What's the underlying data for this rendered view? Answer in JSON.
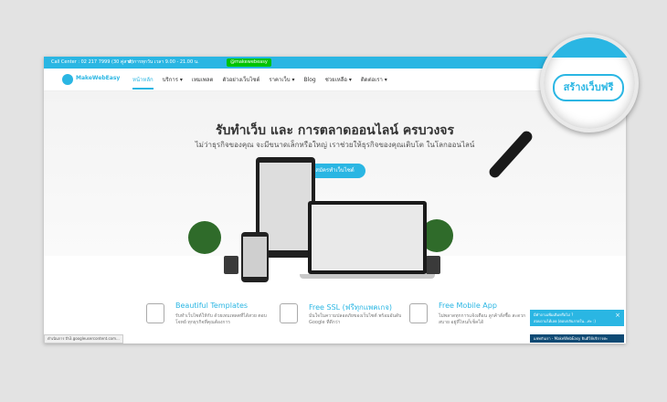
{
  "topbar": {
    "call_center": "Call Center : 02 217 7999 (30 คู่สาย)",
    "hours": "ทำการทุกวัน เวลา 9.00 - 21.00 น.",
    "line_id": "@makewebeasy"
  },
  "nav": {
    "brand": "MakeWebEasy",
    "items": [
      "หน้าหลัก",
      "บริการ ▾",
      "เทมเพลต",
      "ตัวอย่างเว็บไซต์",
      "ราคาเว็บ ▾",
      "Blog",
      "ช่วยเหลือ ▾",
      "ติดต่อเรา ▾"
    ]
  },
  "hero": {
    "title": "รับทำเว็บ และ การตลาดออนไลน์ ครบวงจร",
    "subtitle": "ไม่ว่าธุรกิจของคุณ จะมีขนาดเล็กหรือใหญ่ เราช่วยให้ธุรกิจของคุณเติบโต ในโลกออนไลน์",
    "cta": "สมัครทำเว็บไซต์"
  },
  "features": [
    {
      "title": "Beautiful Templates",
      "desc": "รับทำเว็บไซต์ให้กับ ด้วยเทมเพลตที่ได้สวย ตอบโจทย์ ทุกธุรกิจที่คุณต้องการ"
    },
    {
      "title": "Free SSL (ฟรีทุกแพคเกจ)",
      "desc": "มั่นใจในความปลอดภัยของเว็บไซต์ พร้อมอันดับ Google ที่ดีกว่า"
    },
    {
      "title": "Free Mobile App",
      "desc": "ไม่พลาดทุกการแจ้งเตือน ลูกค้าสั่งซื้อ สะดวก สบาย อยู่ที่ไหนก็เช็คได้"
    }
  ],
  "status": {
    "text": "ดำเนินการ th3.googleusercontent.com..."
  },
  "chat": {
    "line1": "มีคำถามเพิ่มเติมหรือไม่ ?",
    "line2": "สอบถามได้เลย  (ตอบกลับภายใน...ค่ะ :)",
    "close": "×",
    "bar": "แชทกับเรา - MakeWebEasy ยินดีให้บริการค่ะ"
  },
  "magnifier": {
    "button": "สร้างเว็บฟรี"
  },
  "colors": {
    "accent": "#2ab6e3",
    "line": "#00c300"
  }
}
